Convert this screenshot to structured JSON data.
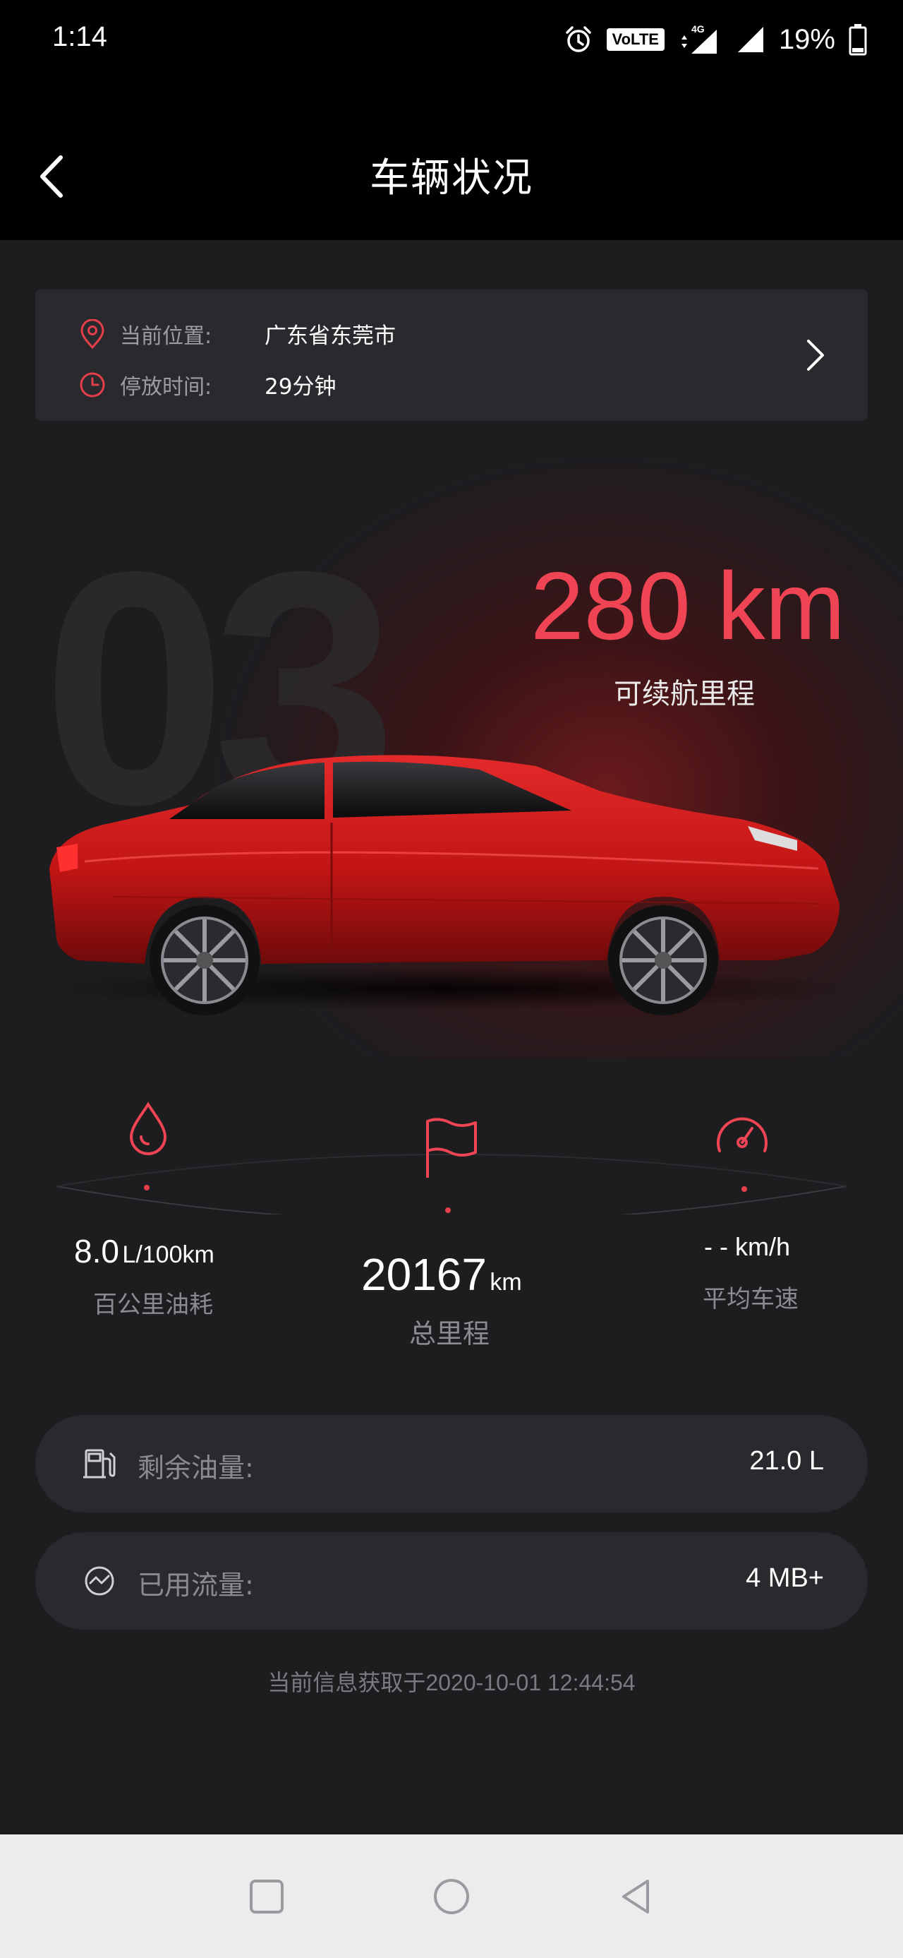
{
  "status_bar": {
    "time": "1:14",
    "volte": "VoLTE",
    "network": "4G",
    "battery": "19%"
  },
  "header": {
    "title": "车辆状况"
  },
  "location": {
    "location_label": "当前位置:",
    "location_value": "广东省东莞市",
    "parked_label": "停放时间:",
    "parked_value": "29分钟"
  },
  "hero": {
    "model_text": "03",
    "range_value": "280 km",
    "range_label": "可续航里程"
  },
  "stats": {
    "fuel_consumption": {
      "value": "8.0",
      "unit": "L/100km",
      "label": "百公里油耗"
    },
    "total_mileage": {
      "value": "20167",
      "unit": "km",
      "label": "总里程"
    },
    "avg_speed": {
      "value": "- -",
      "unit": "km/h",
      "label": "平均车速"
    }
  },
  "info": {
    "fuel_label": "剩余油量:",
    "fuel_value": "21.0 L",
    "data_label": "已用流量:",
    "data_value": "4 MB+"
  },
  "footer": {
    "update_time": "当前信息获取于2020-10-01 12:44:54"
  },
  "colors": {
    "accent": "#ef4453",
    "background": "#1d1d20",
    "card": "#2a2a2e",
    "header": "#000000"
  },
  "icons": {
    "location": "location-pin-icon",
    "clock": "clock-icon",
    "fuel_drop": "drop-icon",
    "flag": "flag-icon",
    "speedometer": "speedometer-icon",
    "fuel_pump": "fuel-pump-icon",
    "data": "data-usage-icon"
  }
}
